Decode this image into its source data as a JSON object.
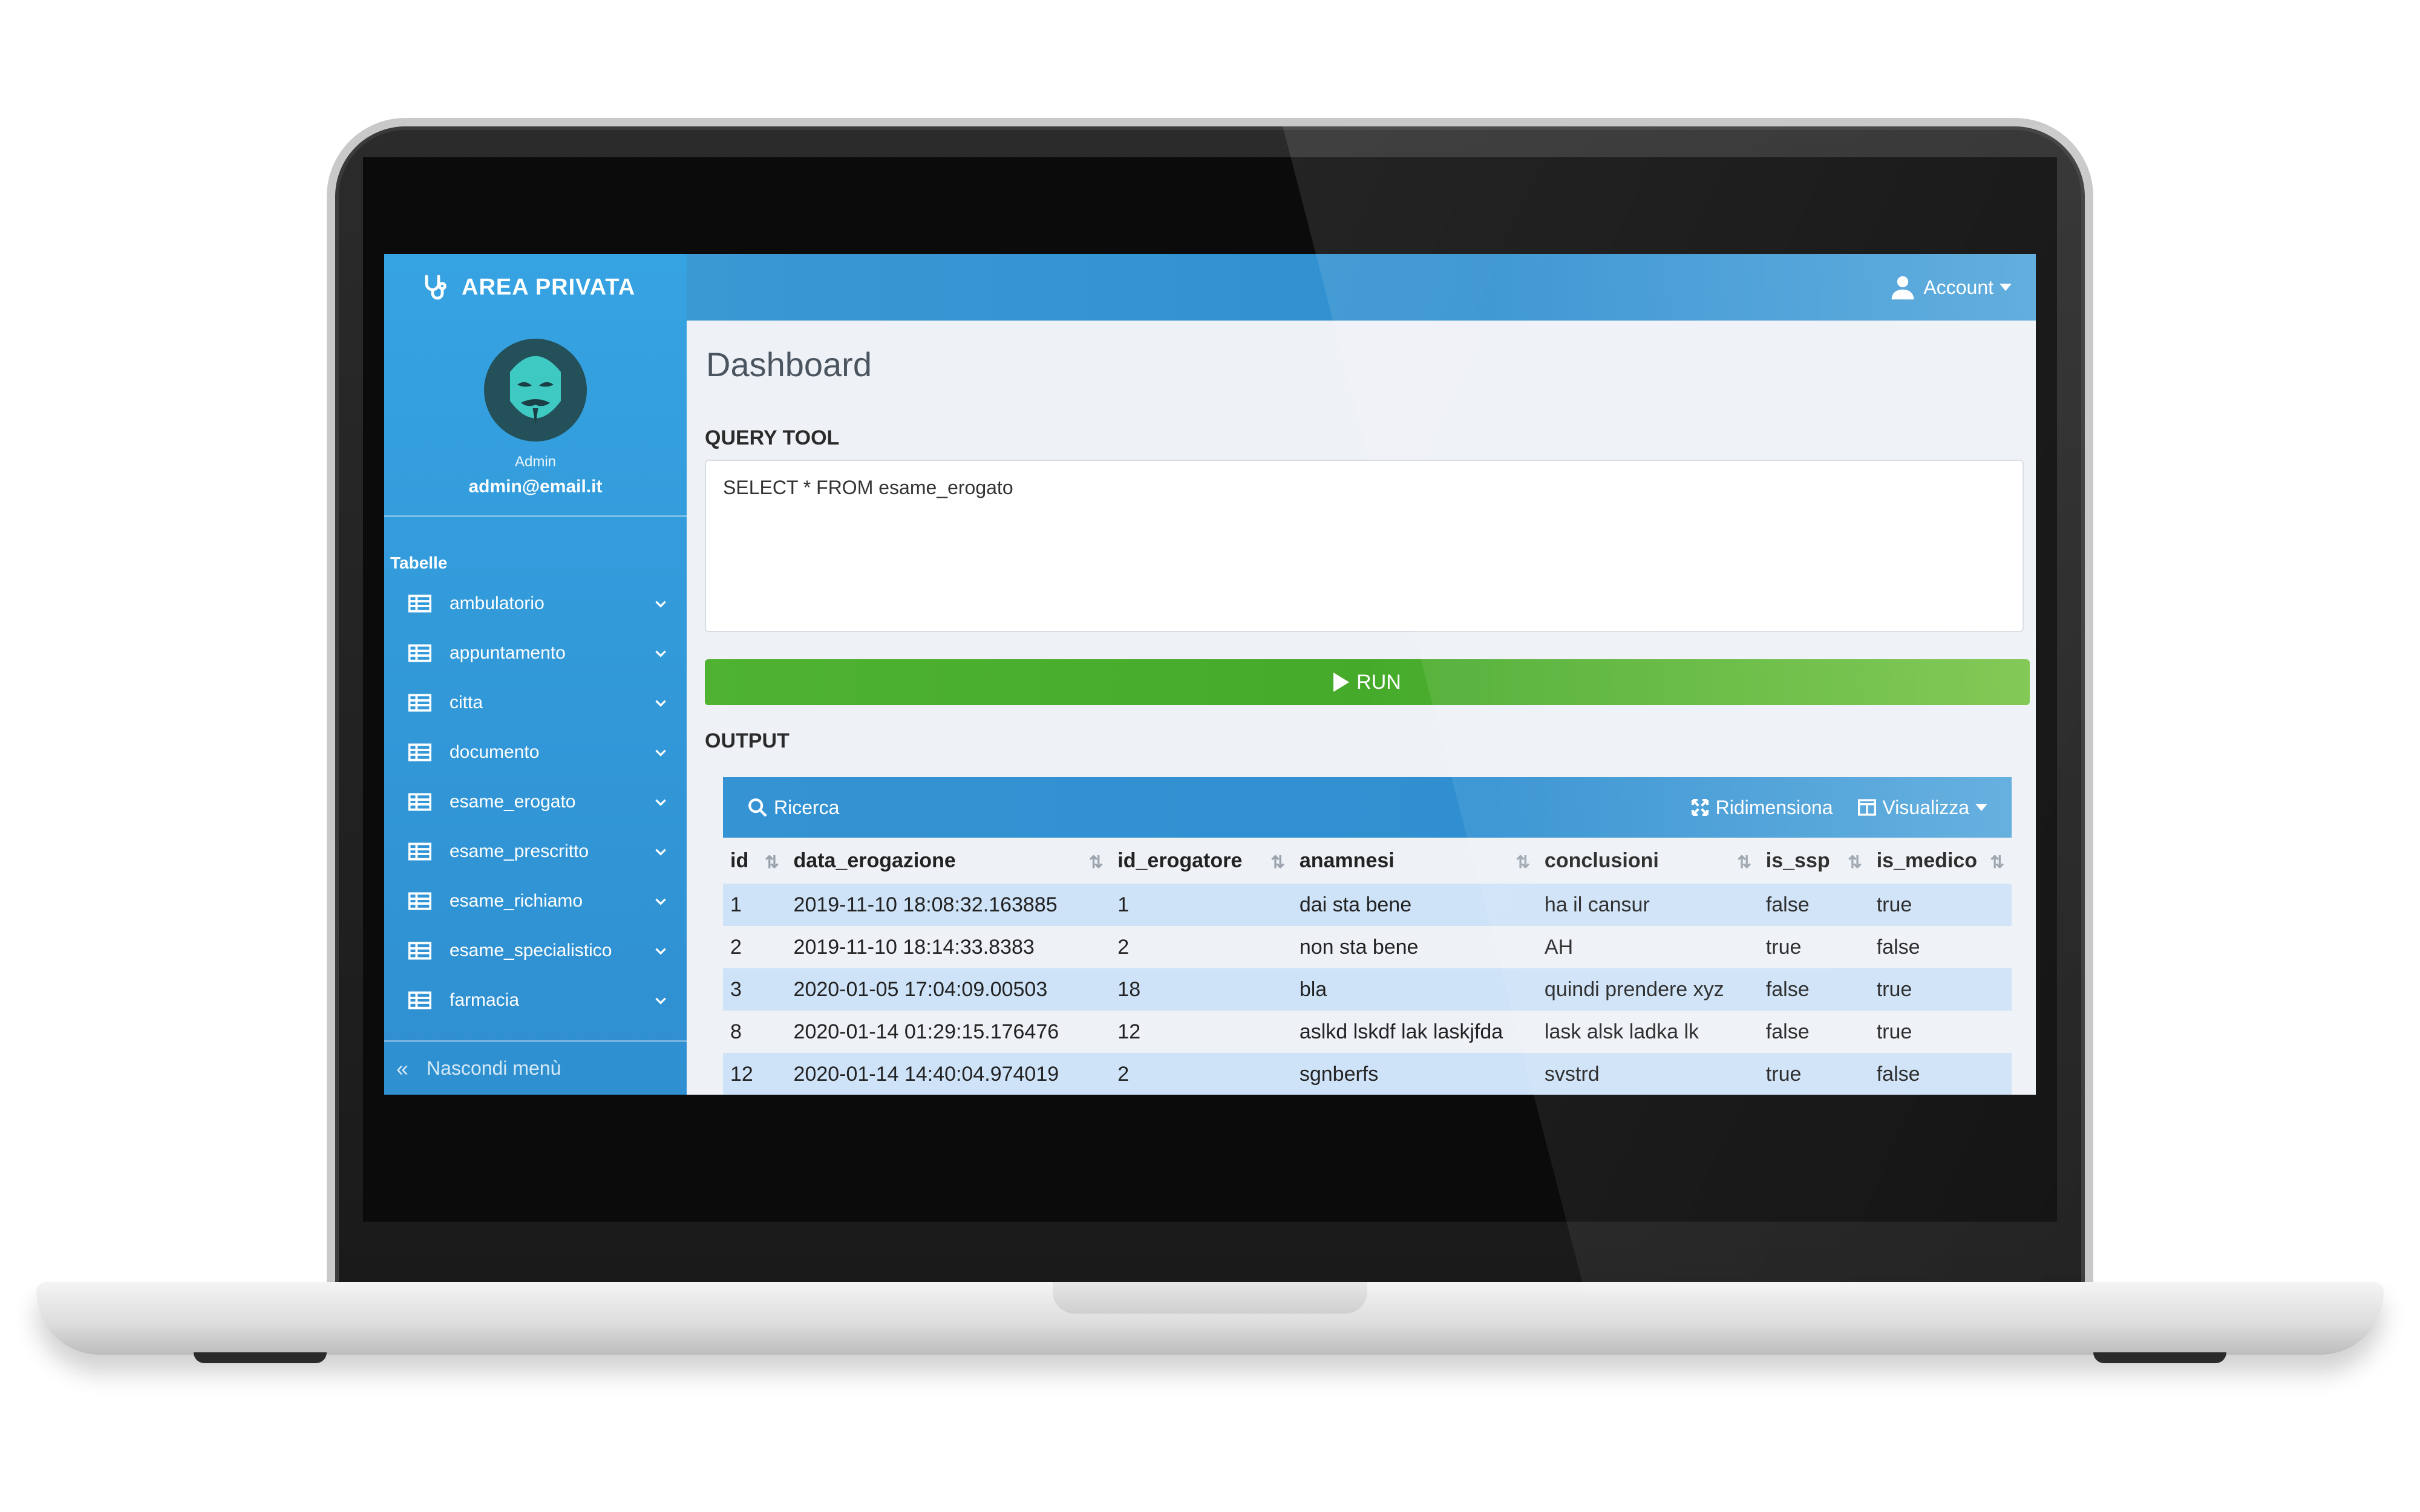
{
  "brand": {
    "title": "AREA PRIVATA"
  },
  "profile": {
    "role": "Admin",
    "email": "admin@email.it"
  },
  "sidebar": {
    "section": "Tabelle",
    "items": [
      {
        "label": "ambulatorio"
      },
      {
        "label": "appuntamento"
      },
      {
        "label": "citta"
      },
      {
        "label": "documento"
      },
      {
        "label": "esame_erogato"
      },
      {
        "label": "esame_prescritto"
      },
      {
        "label": "esame_richiamo"
      },
      {
        "label": "esame_specialistico"
      },
      {
        "label": "farmacia"
      }
    ],
    "hide_label": "Nascondi menù"
  },
  "topbar": {
    "account_label": "Account"
  },
  "main": {
    "title": "Dashboard",
    "query_title": "QUERY TOOL",
    "query_value": "SELECT * FROM esame_erogato",
    "run_label": "RUN",
    "output_title": "OUTPUT"
  },
  "table": {
    "search_label": "Ricerca",
    "resize_label": "Ridimensiona",
    "view_label": "Visualizza",
    "columns": [
      "id",
      "data_erogazione",
      "id_erogatore",
      "anamnesi",
      "conclusioni",
      "is_ssp",
      "is_medico"
    ],
    "rows": [
      [
        "1",
        "2019-11-10 18:08:32.163885",
        "1",
        "dai sta bene",
        "ha il cansur",
        "false",
        "true"
      ],
      [
        "2",
        "2019-11-10 18:14:33.8383",
        "2",
        "non sta bene",
        "AH",
        "true",
        "false"
      ],
      [
        "3",
        "2020-01-05 17:04:09.00503",
        "18",
        "bla",
        "quindi prendere xyz",
        "false",
        "true"
      ],
      [
        "8",
        "2020-01-14 01:29:15.176476",
        "12",
        "aslkd lskdf lak laskjfda",
        "lask alsk ladka lk",
        "false",
        "true"
      ],
      [
        "12",
        "2020-01-14 14:40:04.974019",
        "2",
        "sgnberfs",
        "svstrd",
        "true",
        "false"
      ]
    ]
  },
  "colors": {
    "primary": "#2f8fd0",
    "run": "#4fb231",
    "row_highlight": "#cfe3f8"
  },
  "icons": [
    "stethoscope-icon",
    "anonymous-mask-avatar",
    "table-icon",
    "chevron-down-icon",
    "user-icon",
    "search-icon",
    "expand-icon",
    "columns-icon",
    "double-chevron-left-icon",
    "play-icon",
    "sort-icon"
  ]
}
